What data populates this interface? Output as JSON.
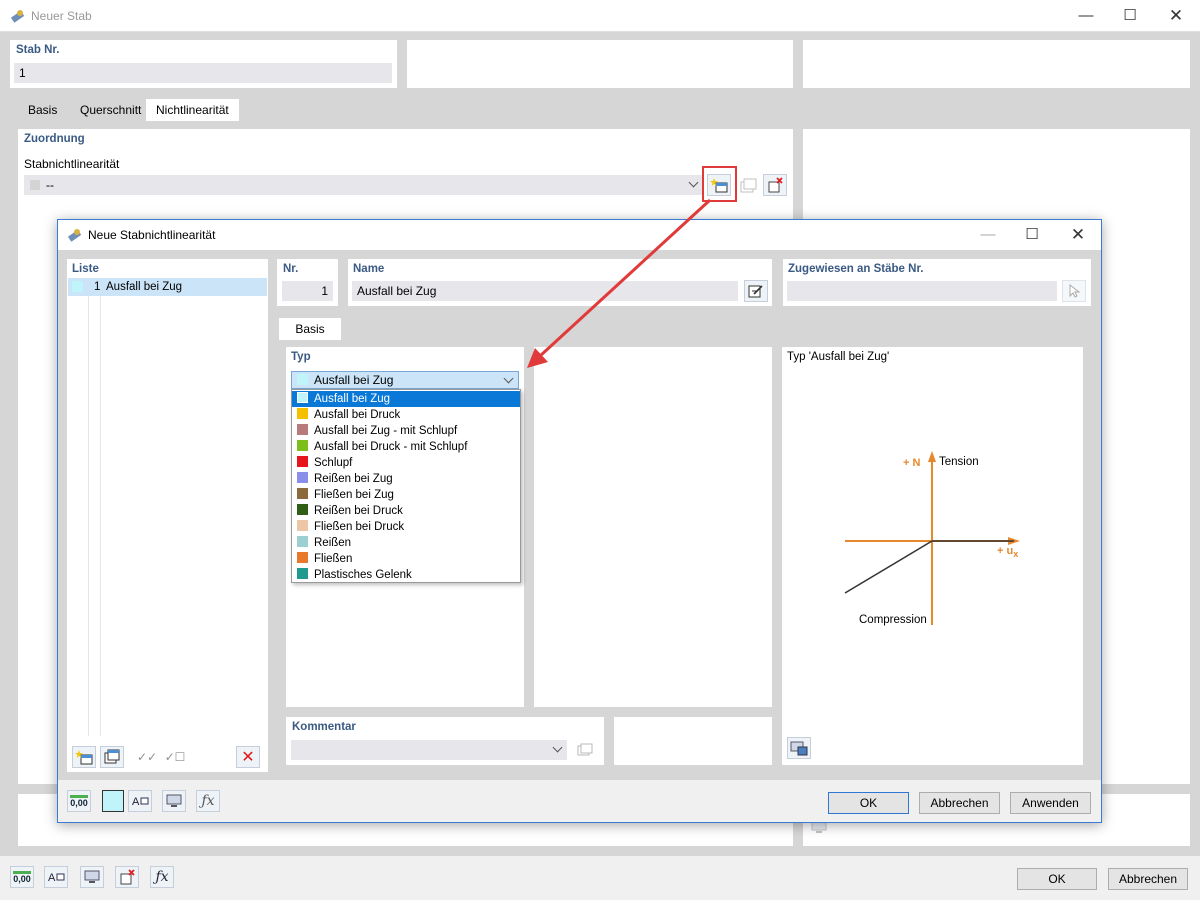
{
  "outer": {
    "title": "Neuer Stab",
    "stab_nr_label": "Stab Nr.",
    "stab_nr_value": "1",
    "tabs": [
      {
        "label": "Basis"
      },
      {
        "label": "Querschnitt"
      },
      {
        "label": "Nichtlinearität"
      }
    ],
    "zuordnung_label": "Zuordnung",
    "stabnl_label": "Stabnichtlinearität",
    "stabnl_value": "--",
    "zero_icon_label": "0,00",
    "ok_label": "OK",
    "cancel_label": "Abbrechen"
  },
  "inner": {
    "title": "Neue Stabnichtlinearität",
    "liste_label": "Liste",
    "list_items": [
      {
        "nr": "1",
        "name": "Ausfall bei Zug"
      }
    ],
    "nr_label": "Nr.",
    "nr_value": "1",
    "name_label": "Name",
    "name_value": "Ausfall bei Zug",
    "assigned_label": "Zugewiesen an Stäbe Nr.",
    "assigned_value": "",
    "tab_basis": "Basis",
    "typ_label": "Typ",
    "typ_selected": "Ausfall bei Zug",
    "typ_options": [
      {
        "label": "Ausfall bei Zug",
        "color": "#bff4fa"
      },
      {
        "label": "Ausfall bei Druck",
        "color": "#f5c000"
      },
      {
        "label": "Ausfall bei Zug - mit Schlupf",
        "color": "#b87b7b"
      },
      {
        "label": "Ausfall bei Druck - mit Schlupf",
        "color": "#7cbf1d"
      },
      {
        "label": "Schlupf",
        "color": "#e8141c"
      },
      {
        "label": "Reißen bei Zug",
        "color": "#8a8ee8"
      },
      {
        "label": "Fließen bei Zug",
        "color": "#8c6a3c"
      },
      {
        "label": "Reißen bei Druck",
        "color": "#2f5e14"
      },
      {
        "label": "Fließen bei Druck",
        "color": "#eec6a6"
      },
      {
        "label": "Reißen",
        "color": "#9ccfd2"
      },
      {
        "label": "Fließen",
        "color": "#e8782c"
      },
      {
        "label": "Plastisches Gelenk",
        "color": "#1e9a8e"
      }
    ],
    "preview_title": "Typ 'Ausfall bei Zug'",
    "diagram": {
      "n_label": "+ N",
      "tension_label": "Tension",
      "ux_label": "+ u",
      "ux_sub": "x",
      "compression_label": "Compression"
    },
    "kommentar_label": "Kommentar",
    "kommentar_value": "",
    "zero_icon_label": "0,00",
    "ok_label": "OK",
    "cancel_label": "Abbrechen",
    "apply_label": "Anwenden"
  },
  "colors": {
    "accent_blue": "#3a5a84",
    "highlight_red": "#e03a3a",
    "diagram_orange": "#e8882c",
    "selection_blue": "#0a78d7"
  }
}
